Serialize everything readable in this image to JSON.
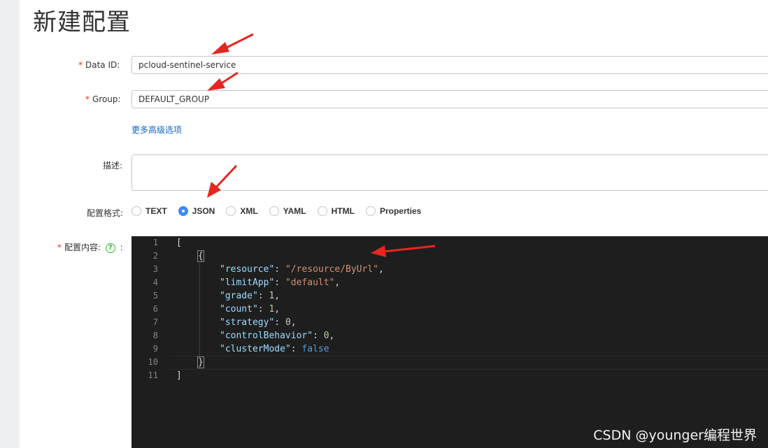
{
  "page": {
    "title": "新建配置"
  },
  "form": {
    "data_id": {
      "label": "Data ID:",
      "value": "pcloud-sentinel-service"
    },
    "group": {
      "label": "Group:",
      "value": "DEFAULT_GROUP"
    },
    "advanced_link": "更多高级选项",
    "description": {
      "label": "描述:",
      "value": ""
    },
    "format": {
      "label": "配置格式:",
      "options": [
        "TEXT",
        "JSON",
        "XML",
        "YAML",
        "HTML",
        "Properties"
      ],
      "selected": "JSON"
    },
    "content": {
      "label": "配置内容:",
      "suffix": ":",
      "help_icon": "question-circle-icon"
    }
  },
  "editor": {
    "line_numbers": [
      "1",
      "2",
      "3",
      "4",
      "5",
      "6",
      "7",
      "8",
      "9",
      "10",
      "11"
    ],
    "code": {
      "l1": "[",
      "l2": "{",
      "resource_key": "\"resource\"",
      "resource_val": "\"/resource/ByUrl\"",
      "limitApp_key": "\"limitApp\"",
      "limitApp_val": "\"default\"",
      "grade_key": "\"grade\"",
      "grade_val": "1",
      "count_key": "\"count\"",
      "count_val": "1",
      "strategy_key": "\"strategy\"",
      "strategy_val": "0",
      "controlBehavior_key": "\"controlBehavior\"",
      "controlBehavior_val": "0",
      "clusterMode_key": "\"clusterMode\"",
      "clusterMode_val": "false",
      "l10": "}",
      "l11": "]"
    }
  },
  "watermark": "CSDN @younger编程世界",
  "colors": {
    "required": "#ff3000",
    "link": "#1064c8",
    "radio_checked": "#3e8af7",
    "editor_bg": "#1e1e1e",
    "annotation_arrow": "#e8251e",
    "help_icon": "#2eb82e"
  }
}
